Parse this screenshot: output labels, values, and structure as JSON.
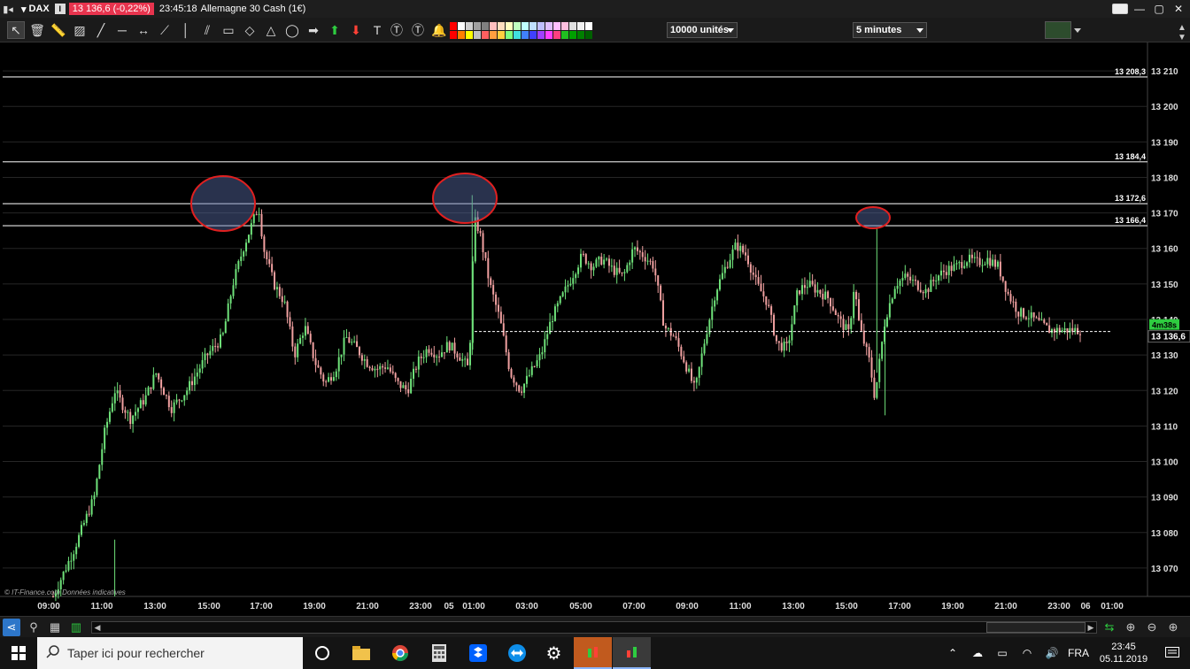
{
  "window": {
    "ticker": "DAX",
    "price_badge": "13 136,6 (-0,22%)",
    "time": "23:45:18",
    "instrument": "Allemagne 30 Cash (1€)"
  },
  "toolbar": {
    "units_dropdown": "10000 unités",
    "period_dropdown": "5 minutes",
    "swatch_colors": [
      "#ff0000",
      "#ffffff",
      "#d0d0d0",
      "#a0a0a0",
      "#808080",
      "#ffbfbf",
      "#ffdfbf",
      "#ffffbf",
      "#bfffbf",
      "#bfffff",
      "#bfdfff",
      "#bfbfff",
      "#dfbfff",
      "#ffbfff",
      "#ffbfdf",
      "#e0e0e0",
      "#f0f0f0",
      "#ffffff",
      "#ff0000",
      "#ff8000",
      "#ffff00",
      "#c0c0c0",
      "#ff6060",
      "#ff9f40",
      "#ffd040",
      "#80ff80",
      "#40e0e0",
      "#4080ff",
      "#4040ff",
      "#a040ff",
      "#ff40ff",
      "#ff4080",
      "#20c020",
      "#00a000",
      "#008000",
      "#006000"
    ]
  },
  "chart_data": {
    "type": "candlestick",
    "y_ticks": [
      "13 210",
      "13 200",
      "13 190",
      "13 180",
      "13 170",
      "13 160",
      "13 150",
      "13 140",
      "13 130",
      "13 120",
      "13 110",
      "13 100",
      "13 090",
      "13 080",
      "13 070"
    ],
    "ylim": [
      13062,
      13218
    ],
    "x_ticks": [
      "09:00",
      "11:00",
      "13:00",
      "15:00",
      "17:00",
      "19:00",
      "21:00",
      "23:00",
      "05",
      "01:00",
      "03:00",
      "05:00",
      "07:00",
      "09:00",
      "11:00",
      "13:00",
      "15:00",
      "17:00",
      "19:00",
      "21:00",
      "23:00",
      "06",
      "01:00"
    ],
    "horizontal_lines": [
      {
        "label": "13 208,3",
        "value": 13208.3
      },
      {
        "label": "13 184,4",
        "value": 13184.4
      },
      {
        "label": "13 172,6",
        "value": 13172.6
      },
      {
        "label": "13 166,4",
        "value": 13166.4
      }
    ],
    "current_price": {
      "label": "13 136,6",
      "value": 13136.6,
      "timer": "4m38s"
    },
    "price_path": [
      [
        0,
        13062
      ],
      [
        0.02,
        13075
      ],
      [
        0.04,
        13090
      ],
      [
        0.05,
        13108
      ],
      [
        0.06,
        13120
      ],
      [
        0.075,
        13112
      ],
      [
        0.09,
        13118
      ],
      [
        0.1,
        13125
      ],
      [
        0.115,
        13115
      ],
      [
        0.13,
        13120
      ],
      [
        0.15,
        13130
      ],
      [
        0.165,
        13135
      ],
      [
        0.175,
        13150
      ],
      [
        0.185,
        13160
      ],
      [
        0.195,
        13168
      ],
      [
        0.2,
        13172
      ],
      [
        0.205,
        13160
      ],
      [
        0.215,
        13150
      ],
      [
        0.225,
        13145
      ],
      [
        0.235,
        13130
      ],
      [
        0.245,
        13138
      ],
      [
        0.255,
        13128
      ],
      [
        0.265,
        13122
      ],
      [
        0.275,
        13126
      ],
      [
        0.285,
        13135
      ],
      [
        0.295,
        13132
      ],
      [
        0.305,
        13128
      ],
      [
        0.315,
        13126
      ],
      [
        0.325,
        13127
      ],
      [
        0.335,
        13122
      ],
      [
        0.345,
        13120
      ],
      [
        0.355,
        13128
      ],
      [
        0.365,
        13132
      ],
      [
        0.375,
        13130
      ],
      [
        0.385,
        13133
      ],
      [
        0.395,
        13130
      ],
      [
        0.405,
        13126
      ],
      [
        0.41,
        13168
      ],
      [
        0.415,
        13165
      ],
      [
        0.425,
        13150
      ],
      [
        0.435,
        13140
      ],
      [
        0.445,
        13125
      ],
      [
        0.455,
        13120
      ],
      [
        0.465,
        13125
      ],
      [
        0.475,
        13130
      ],
      [
        0.485,
        13140
      ],
      [
        0.495,
        13146
      ],
      [
        0.505,
        13152
      ],
      [
        0.515,
        13158
      ],
      [
        0.525,
        13155
      ],
      [
        0.535,
        13157
      ],
      [
        0.545,
        13154
      ],
      [
        0.555,
        13152
      ],
      [
        0.565,
        13160
      ],
      [
        0.575,
        13158
      ],
      [
        0.585,
        13155
      ],
      [
        0.595,
        13138
      ],
      [
        0.605,
        13135
      ],
      [
        0.615,
        13128
      ],
      [
        0.625,
        13120
      ],
      [
        0.635,
        13135
      ],
      [
        0.645,
        13148
      ],
      [
        0.655,
        13155
      ],
      [
        0.665,
        13161
      ],
      [
        0.675,
        13158
      ],
      [
        0.685,
        13150
      ],
      [
        0.695,
        13145
      ],
      [
        0.705,
        13133
      ],
      [
        0.715,
        13132
      ],
      [
        0.725,
        13148
      ],
      [
        0.735,
        13150
      ],
      [
        0.745,
        13148
      ],
      [
        0.755,
        13146
      ],
      [
        0.765,
        13140
      ],
      [
        0.775,
        13136
      ],
      [
        0.78,
        13150
      ],
      [
        0.785,
        13138
      ],
      [
        0.795,
        13128
      ],
      [
        0.8,
        13118
      ],
      [
        0.81,
        13140
      ],
      [
        0.82,
        13150
      ],
      [
        0.83,
        13152
      ],
      [
        0.84,
        13150
      ],
      [
        0.85,
        13148
      ],
      [
        0.86,
        13152
      ],
      [
        0.87,
        13154
      ],
      [
        0.88,
        13155
      ],
      [
        0.89,
        13157
      ],
      [
        0.9,
        13156
      ],
      [
        0.91,
        13157
      ],
      [
        0.92,
        13155
      ],
      [
        0.93,
        13147
      ],
      [
        0.94,
        13142
      ],
      [
        0.95,
        13141
      ],
      [
        0.96,
        13139
      ],
      [
        0.97,
        13137
      ]
    ]
  },
  "watermark": "© IT-Finance.com  Données indicatives",
  "taskbar": {
    "search_placeholder": "Taper ici pour rechercher",
    "lang": "FRA",
    "time": "23:45",
    "date": "05.11.2019"
  }
}
